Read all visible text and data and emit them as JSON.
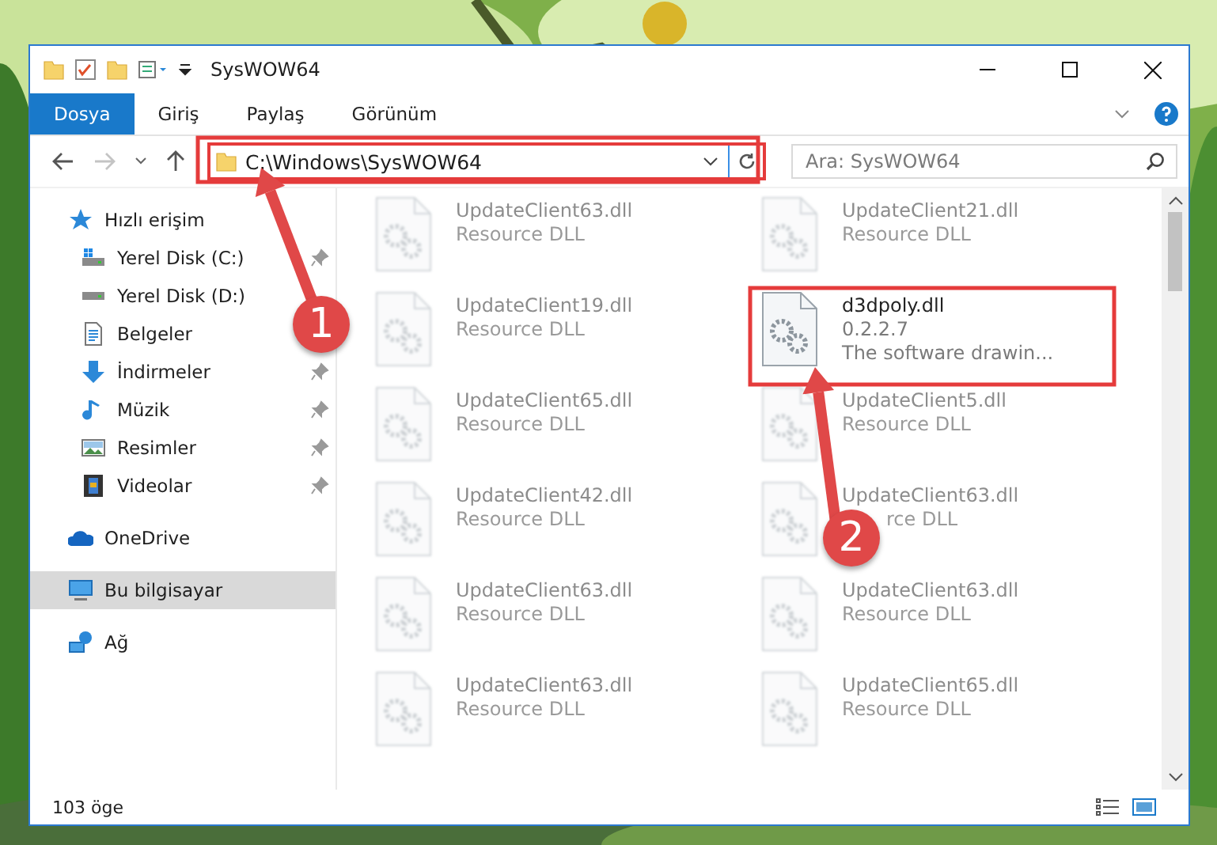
{
  "window": {
    "title": "SysWOW64"
  },
  "ribbon_tabs": [
    {
      "label": "Dosya",
      "selected": true
    },
    {
      "label": "Giriş",
      "selected": false
    },
    {
      "label": "Paylaş",
      "selected": false
    },
    {
      "label": "Görünüm",
      "selected": false
    }
  ],
  "address": {
    "path": "C:\\Windows\\SysWOW64"
  },
  "search": {
    "placeholder": "Ara: SysWOW64"
  },
  "sidebar": {
    "items": [
      {
        "label": "Hızlı erişim",
        "selected": false,
        "children": [
          {
            "label": "Yerel Disk (C:)",
            "pinned": true
          },
          {
            "label": "Yerel Disk (D:)",
            "pinned": false
          },
          {
            "label": "Belgeler",
            "pinned": false
          },
          {
            "label": "İndirmeler",
            "pinned": true
          },
          {
            "label": "Müzik",
            "pinned": true
          },
          {
            "label": "Resimler",
            "pinned": true
          },
          {
            "label": "Videolar",
            "pinned": true
          }
        ]
      },
      {
        "label": "OneDrive",
        "selected": false
      },
      {
        "label": "Bu bilgisayar",
        "selected": true
      },
      {
        "label": "Ağ",
        "selected": false
      }
    ]
  },
  "files": [
    {
      "name": "UpdateClient63.dll",
      "details": [
        "Resource DLL"
      ],
      "kind": "dim"
    },
    {
      "name": "UpdateClient21.dll",
      "details": [
        "Resource DLL"
      ],
      "kind": "dim"
    },
    {
      "name": "UpdateClient19.dll",
      "details": [
        "Resource DLL"
      ],
      "kind": "dim"
    },
    {
      "name": "d3dpoly.dll",
      "details": [
        "0.2.2.7",
        "The software drawin..."
      ],
      "kind": "clear"
    },
    {
      "name": "UpdateClient65.dll",
      "details": [
        "Resource DLL"
      ],
      "kind": "dim"
    },
    {
      "name": "UpdateClient5.dll",
      "details": [
        "Resource DLL"
      ],
      "kind": "dim"
    },
    {
      "name": "UpdateClient42.dll",
      "details": [
        "Resource DLL"
      ],
      "kind": "dim"
    },
    {
      "name": "UpdateClient63.dll",
      "details": [
        "rce DLL"
      ],
      "kind": "covered"
    },
    {
      "name": "UpdateClient63.dll",
      "details": [
        "Resource DLL"
      ],
      "kind": "dim"
    },
    {
      "name": "UpdateClient63.dll",
      "details": [
        "Resource DLL"
      ],
      "kind": "dim"
    },
    {
      "name": "UpdateClient63.dll",
      "details": [
        "Resource DLL"
      ],
      "kind": "dim"
    },
    {
      "name": "UpdateClient65.dll",
      "details": [
        "Resource DLL"
      ],
      "kind": "dim"
    }
  ],
  "status_bar": {
    "count": "103 öge"
  },
  "callouts": [
    {
      "label": "1"
    },
    {
      "label": "2"
    }
  ]
}
